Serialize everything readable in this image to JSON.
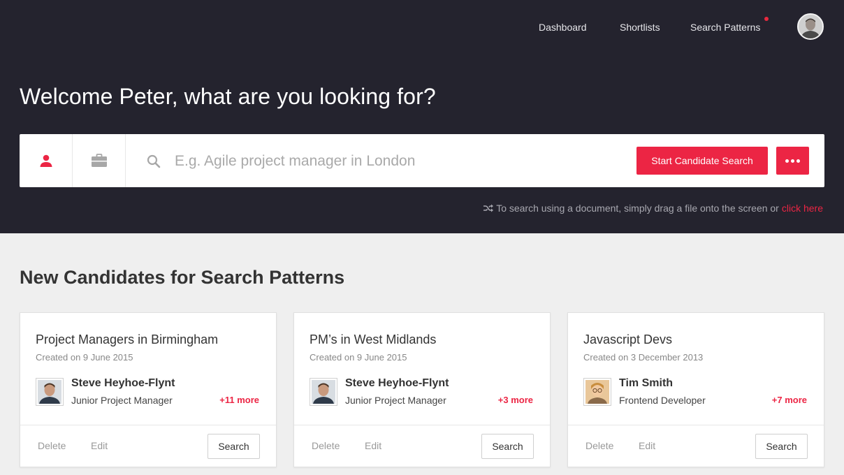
{
  "nav": {
    "items": [
      {
        "label": "Dashboard"
      },
      {
        "label": "Shortlists"
      },
      {
        "label": "Search Patterns",
        "notification": true
      }
    ],
    "notification_color": "#e8293f"
  },
  "hero": {
    "welcome": "Welcome Peter, what are you looking for?",
    "search_placeholder": "E.g. Agile project manager in London",
    "start_button": "Start Candidate Search",
    "drag_hint": "To search using a document, simply drag a file onto the screen or",
    "click_here": "click here"
  },
  "section": {
    "title": "New Candidates for Search Patterns"
  },
  "cards": [
    {
      "title": "Project Managers in Birmingham",
      "created": "Created on 9 June 2015",
      "candidate_name": "Steve Heyhoe-Flynt",
      "candidate_role": "Junior Project Manager",
      "more": "+11 more",
      "delete": "Delete",
      "edit": "Edit",
      "search": "Search"
    },
    {
      "title": "PM’s in West Midlands",
      "created": "Created on 9 June 2015",
      "candidate_name": "Steve Heyhoe-Flynt",
      "candidate_role": "Junior Project Manager",
      "more": "+3 more",
      "delete": "Delete",
      "edit": "Edit",
      "search": "Search"
    },
    {
      "title": "Javascript Devs",
      "created": "Created on 3 December 2013",
      "candidate_name": "Tim Smith",
      "candidate_role": "Frontend Developer",
      "more": "+7 more",
      "delete": "Delete",
      "edit": "Edit",
      "search": "Search"
    }
  ],
  "colors": {
    "accent": "#ec2544",
    "header_bg": "#24232e",
    "page_bg": "#efefef"
  }
}
